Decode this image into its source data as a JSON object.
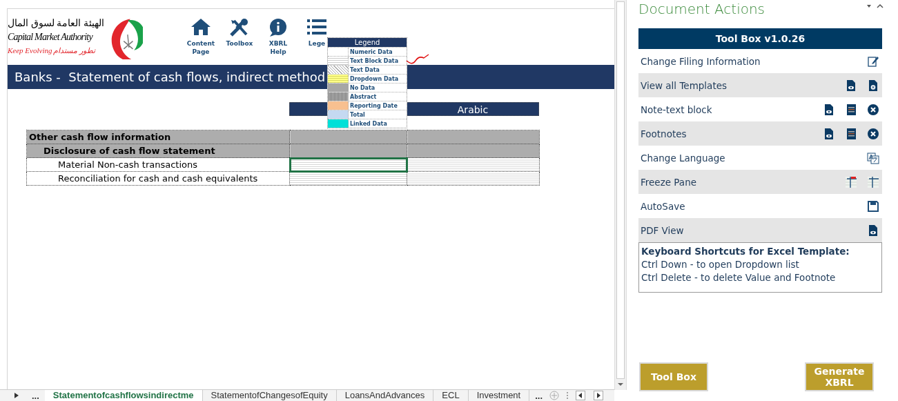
{
  "logo": {
    "arabic_name": "الهيئة العامة لسوق المال",
    "name": "Capital Market Authority",
    "tagline": "Keep Evolving",
    "arabic_tagline": "تطور مستدام"
  },
  "nav": [
    {
      "kind": "home",
      "label": "Content Page"
    },
    {
      "kind": "tools",
      "label": "Toolbox"
    },
    {
      "kind": "help",
      "label": "XBRL Help"
    },
    {
      "kind": "list",
      "label": "Lege"
    }
  ],
  "legend": {
    "title": "Legend",
    "items": [
      {
        "kind": "numeric",
        "label": "Numeric Data"
      },
      {
        "kind": "textblock",
        "label": "Text Block Data"
      },
      {
        "kind": "text",
        "label": "Text Data"
      },
      {
        "kind": "dropdown",
        "label": "Dropdown Data"
      },
      {
        "kind": "nodata",
        "label": "No Data"
      },
      {
        "kind": "abstract",
        "label": "Abstract"
      },
      {
        "kind": "reporting",
        "label": "Reporting Date"
      },
      {
        "kind": "total",
        "label": "Total"
      },
      {
        "kind": "linked",
        "label": "Linked Data"
      }
    ]
  },
  "page_title": "Banks -  Statement of cash flows, indirect method",
  "table": {
    "columns": [
      "Arabic"
    ],
    "rows": [
      {
        "kind": "abstract",
        "label": "Other cash flow information",
        "children": [
          {
            "kind": "abstract",
            "label": "Disclosure of cash flow statement",
            "children": [
              {
                "kind": "textblock",
                "label": "Material Non-cash transactions",
                "cells": [
                  {
                    "selected": true
                  },
                  {
                    "selected": false
                  }
                ]
              },
              {
                "kind": "textblock",
                "label": "Reconciliation for cash and cash equivalents",
                "cells": [
                  {
                    "selected": false
                  },
                  {
                    "selected": false
                  }
                ]
              }
            ]
          }
        ]
      }
    ]
  },
  "sheet_tabs": {
    "more_left": "...",
    "tabs": [
      {
        "label": "Statementofcashflowsindirectme",
        "selected": true
      },
      {
        "label": "StatementofChangesofEquity",
        "selected": false
      },
      {
        "label": "LoansAndAdvances",
        "selected": false
      },
      {
        "label": "ECL",
        "selected": false
      },
      {
        "label": "Investment",
        "selected": false
      }
    ],
    "more_right": "..."
  },
  "pane": {
    "title": "Document Actions",
    "toolbox_title": "Tool Box v1.0.26",
    "items": [
      {
        "label": "Change Filing Information",
        "icons": [
          {
            "kind": "edit"
          }
        ]
      },
      {
        "label": "View all Templates",
        "icons": [
          {
            "kind": "doc-view"
          },
          {
            "kind": "doc-close"
          }
        ]
      },
      {
        "label": "Note-text block",
        "icons": [
          {
            "kind": "doc-view"
          },
          {
            "kind": "notes"
          },
          {
            "kind": "close"
          }
        ]
      },
      {
        "label": "Footnotes",
        "icons": [
          {
            "kind": "doc-view"
          },
          {
            "kind": "notes"
          },
          {
            "kind": "close"
          }
        ]
      },
      {
        "label": "Change Language",
        "icons": [
          {
            "kind": "translate"
          }
        ]
      },
      {
        "label": "Freeze Pane",
        "icons": [
          {
            "kind": "freeze-flag"
          },
          {
            "kind": "freeze"
          }
        ]
      },
      {
        "label": "AutoSave",
        "icons": [
          {
            "kind": "save"
          }
        ]
      },
      {
        "label": "PDF View",
        "icons": [
          {
            "kind": "doc-view"
          }
        ]
      }
    ],
    "shortcuts": {
      "title": "Keyboard Shortcuts for Excel Template:",
      "lines": [
        "Ctrl Down - to open Dropdown list",
        "Ctrl Delete - to delete Value and Footnote"
      ]
    },
    "buttons": [
      "Tool Box",
      "Generate XBRL"
    ]
  }
}
